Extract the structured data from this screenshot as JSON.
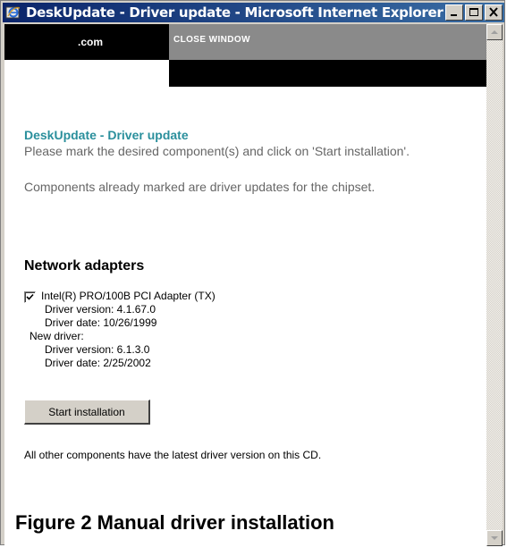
{
  "window": {
    "title": "DeskUpdate - Driver update - Microsoft Internet Explorer",
    "titlebar_colors": [
      "#0a246a",
      "#3a6ea5"
    ]
  },
  "header": {
    "brand_link": ".com",
    "close_link": "CLOSE WINDOW"
  },
  "content": {
    "heading": "DeskUpdate - Driver update",
    "instruction": "Please mark the desired component(s) and click on 'Start installation'.",
    "note": "Components already marked are driver updates for the chipset.",
    "section_title": "Network adapters",
    "component": {
      "checked": true,
      "name": "Intel(R) PRO/100B PCI Adapter (TX)",
      "current_version": "Driver version: 4.1.67.0",
      "current_date": "Driver date: 10/26/1999",
      "new_driver_label": "New driver:",
      "new_version": "Driver version: 6.1.3.0",
      "new_date": "Driver date: 2/25/2002"
    },
    "start_button": "Start installation",
    "footer_note": "All other components have the latest driver version on this CD."
  },
  "caption": "Figure 2 Manual driver installation",
  "colors": {
    "heading": "#2a8f9c",
    "body_gray": "#666666",
    "header_black": "#000000",
    "header_gray": "#8a8a8a"
  }
}
